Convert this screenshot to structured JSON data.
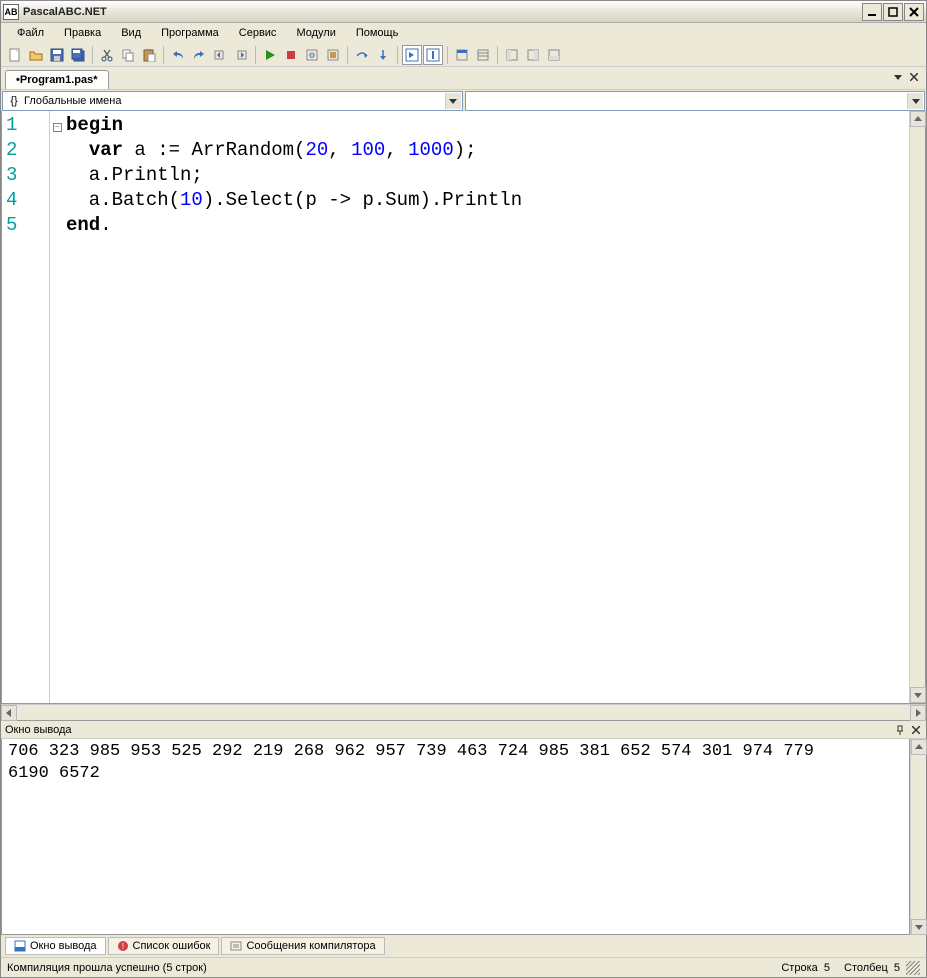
{
  "title": "PascalABC.NET",
  "menus": [
    "Файл",
    "Правка",
    "Вид",
    "Программа",
    "Сервис",
    "Модули",
    "Помощь"
  ],
  "tab": "•Program1.pas*",
  "scope_left": "Глобальные имена",
  "scope_right": "",
  "lines": [
    "1",
    "2",
    "3",
    "4",
    "5"
  ],
  "code": {
    "l1_kw": "begin",
    "l2_kw": "var",
    "l2_rest_a": " a := ArrRandom(",
    "l2_n1": "20",
    "l2_n2": "100",
    "l2_n3": "1000",
    "l2_rest_b": ");",
    "l3": "  a.Println;",
    "l4_a": "  a.Batch(",
    "l4_n": "10",
    "l4_b": ").Select(p -> p.Sum).Println",
    "l5_kw": "end",
    "l5_b": "."
  },
  "output_title": "Окно вывода",
  "output_text": "706 323 985 953 525 292 219 268 962 957 739 463 724 985 381 652 574 301 974 779 \n6190 6572 ",
  "bottom_tabs": {
    "t1": "Окно вывода",
    "t2": "Список ошибок",
    "t3": "Сообщения компилятора"
  },
  "status_left": "Компиляция прошла успешно (5 строк)",
  "status_line_lbl": "Строка",
  "status_line_val": "5",
  "status_col_lbl": "Столбец",
  "status_col_val": "5"
}
